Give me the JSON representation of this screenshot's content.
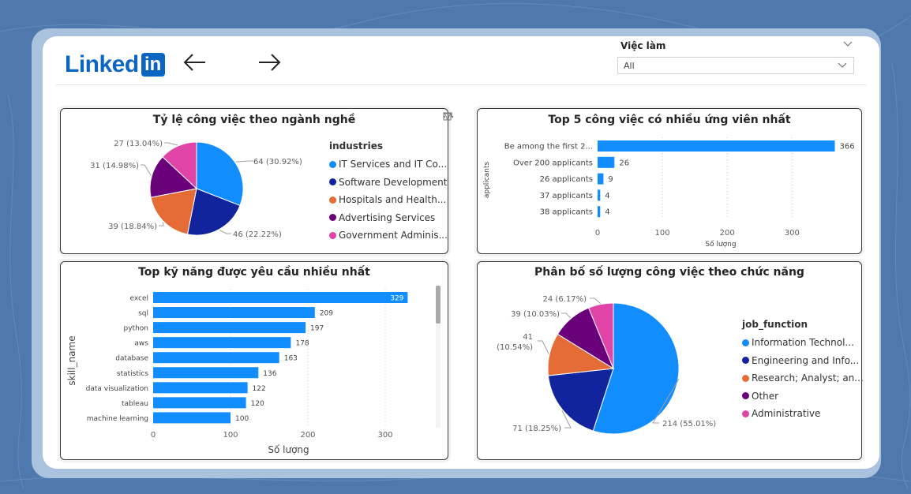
{
  "header": {
    "logo_text": "Linked",
    "logo_box": "in",
    "back_icon": "arrow-left-icon",
    "forward_icon": "arrow-right-icon"
  },
  "slicer": {
    "title": "Việc làm",
    "value": "All"
  },
  "colors": {
    "blue": "#118DFF",
    "navy": "#12239E",
    "orange": "#E66C37",
    "purple": "#6B007B",
    "pink": "#E044A7",
    "background": "#4f79ad"
  },
  "chart_data": [
    {
      "type": "pie",
      "title": "Tỷ lệ công việc theo ngành nghề",
      "legend_title": "industries",
      "legend_position": "right",
      "categories": [
        "IT Services and IT Co...",
        "Software Development",
        "Hospitals and Health...",
        "Advertising Services",
        "Government Adminis..."
      ],
      "values": [
        64,
        46,
        39,
        31,
        27
      ],
      "labels": [
        "64 (30.92%)",
        "46 (22.22%)",
        "39 (18.84%)",
        "31 (14.98%)",
        "27 (13.04%)"
      ],
      "colors": [
        "#118DFF",
        "#12239E",
        "#E66C37",
        "#6B007B",
        "#E044A7"
      ]
    },
    {
      "type": "bar",
      "orientation": "horizontal",
      "title": "Top 5 công việc có nhiều ứng viên nhất",
      "categories": [
        "Be among the first 2...",
        "Over 200 applicants",
        "26 applicants",
        "37 applicants",
        "38 applicants"
      ],
      "values": [
        366,
        26,
        9,
        4,
        4
      ],
      "xlabel": "Số lượng",
      "ylabel": "applicants",
      "xticks": [
        0,
        100,
        200,
        300
      ],
      "xlim": [
        0,
        380
      ],
      "grid": true
    },
    {
      "type": "bar",
      "orientation": "horizontal",
      "title": "Top kỹ năng được yêu cầu nhiều nhất",
      "categories": [
        "excel",
        "sql",
        "python",
        "aws",
        "database",
        "statistics",
        "data visualization",
        "tableau",
        "machine learning"
      ],
      "values": [
        329,
        209,
        197,
        178,
        163,
        136,
        122,
        120,
        100
      ],
      "xlabel": "Số lượng",
      "ylabel": "skill_name",
      "xticks": [
        0,
        100,
        200,
        300
      ],
      "xlim": [
        0,
        350
      ],
      "grid": true
    },
    {
      "type": "pie",
      "title": "Phân bố số lượng công việc theo chức năng",
      "legend_title": "job_function",
      "legend_position": "right",
      "categories": [
        "Information Technol...",
        "Engineering and Info...",
        "Research; Analyst; an...",
        "Other",
        "Administrative"
      ],
      "values": [
        214,
        71,
        41,
        39,
        24
      ],
      "labels": [
        "214 (55.01%)",
        "71 (18.25%)",
        "41 (10.54%)",
        "39 (10.03%)",
        "24 (6.17%)"
      ],
      "colors": [
        "#118DFF",
        "#12239E",
        "#E66C37",
        "#6B007B",
        "#E044A7"
      ]
    }
  ]
}
